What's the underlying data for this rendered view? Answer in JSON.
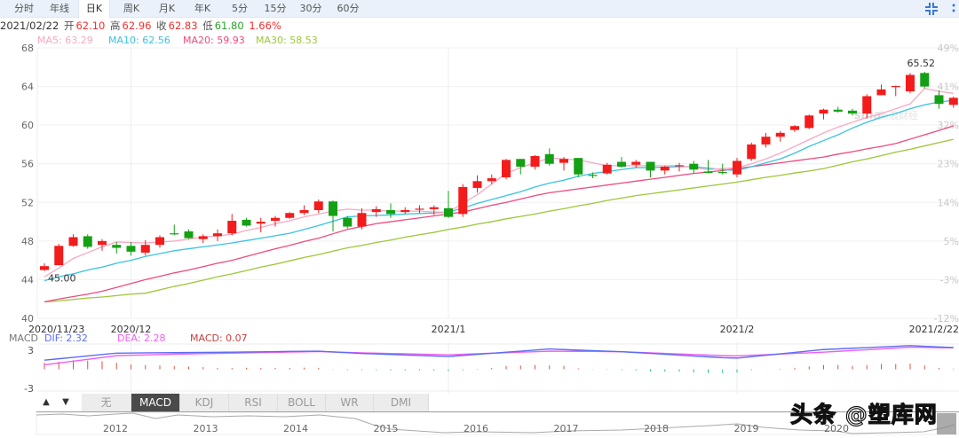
{
  "tabs": [
    {
      "label": "分时",
      "active": false
    },
    {
      "label": "年线",
      "active": false
    },
    {
      "label": "日K",
      "active": true
    },
    {
      "label": "周K",
      "active": false
    },
    {
      "label": "月K",
      "active": false
    },
    {
      "label": "年K",
      "active": false
    },
    {
      "label": "5分",
      "active": false
    },
    {
      "label": "15分",
      "active": false
    },
    {
      "label": "30分",
      "active": false
    },
    {
      "label": "60分",
      "active": false
    }
  ],
  "toolbar": {
    "fullscreen_icon": "collapse-fullscreen-icon",
    "more_icon": "vertical-dots-icon"
  },
  "quote": {
    "date": "2021/02/22",
    "open_label": "开",
    "open": "62.10",
    "high_label": "高",
    "high": "62.96",
    "close_label": "收",
    "close": "62.83",
    "low_label": "低",
    "low": "61.80",
    "change_pct": "1.66%"
  },
  "ma_legend": {
    "ma5": "MA5: 63.29",
    "ma10": "MA10: 62.56",
    "ma20": "MA20: 59.93",
    "ma30": "MA30: 58.53"
  },
  "colors": {
    "up": "#f21c1c",
    "down": "#14a014",
    "ma5": "#f7a8c4",
    "ma10": "#38c3e0",
    "ma20": "#ee4a7c",
    "ma30": "#9dc63a",
    "dif": "#5b6ef5",
    "dea": "#f05ef0",
    "tab_bg": "#eaf1fb",
    "indicator_active": "#4a4a4a"
  },
  "watermark_logo": "sina 新浪财经",
  "chart_data": {
    "type": "candlestick",
    "ylim": [
      40,
      68
    ],
    "y_ticks": [
      "68",
      "64",
      "60",
      "56",
      "52",
      "48",
      "44",
      "40"
    ],
    "y_ticks_right": [
      "49%",
      "41%",
      "32%",
      "23%",
      "14%",
      "5%",
      "-3%",
      "-12%"
    ],
    "x_labels": [
      {
        "label": "2020/11/23",
        "index": 0
      },
      {
        "label": "2020/12",
        "index": 6
      },
      {
        "label": "2021/1",
        "index": 28
      },
      {
        "label": "2021/2",
        "index": 48
      },
      {
        "label": "2021/2/22",
        "index": 63
      }
    ],
    "annotations": {
      "max": "65.52",
      "min": "45.00"
    },
    "ohlc": [
      [
        45.0,
        45.7,
        44.9,
        45.4
      ],
      [
        45.5,
        47.7,
        45.5,
        47.5
      ],
      [
        47.5,
        48.7,
        47.4,
        48.4
      ],
      [
        48.5,
        48.7,
        47.2,
        47.4
      ],
      [
        47.6,
        48.2,
        47.0,
        48.0
      ],
      [
        47.6,
        47.9,
        46.7,
        47.3
      ],
      [
        47.5,
        47.9,
        46.5,
        46.9
      ],
      [
        46.8,
        48.1,
        46.5,
        47.6
      ],
      [
        47.6,
        48.6,
        47.3,
        48.4
      ],
      [
        48.8,
        49.7,
        48.6,
        48.7
      ],
      [
        49.0,
        49.2,
        48.2,
        48.3
      ],
      [
        48.2,
        48.7,
        47.8,
        48.5
      ],
      [
        48.5,
        49.2,
        48.0,
        48.8
      ],
      [
        48.8,
        50.8,
        48.6,
        50.1
      ],
      [
        50.2,
        50.4,
        49.5,
        49.6
      ],
      [
        49.8,
        50.4,
        48.9,
        50.0
      ],
      [
        50.1,
        50.6,
        49.5,
        50.4
      ],
      [
        50.4,
        51.0,
        50.3,
        50.9
      ],
      [
        50.9,
        51.7,
        50.7,
        51.2
      ],
      [
        51.2,
        52.3,
        50.9,
        52.1
      ],
      [
        52.1,
        52.2,
        49.0,
        50.6
      ],
      [
        50.4,
        50.6,
        49.3,
        49.5
      ],
      [
        49.5,
        51.4,
        49.2,
        50.9
      ],
      [
        51.0,
        51.6,
        50.5,
        51.3
      ],
      [
        51.2,
        51.9,
        50.4,
        50.8
      ],
      [
        51.0,
        51.5,
        50.8,
        51.2
      ],
      [
        51.3,
        51.7,
        50.9,
        51.35
      ],
      [
        51.3,
        51.7,
        50.7,
        51.5
      ],
      [
        51.4,
        53.2,
        50.4,
        50.5
      ],
      [
        50.8,
        53.9,
        50.5,
        53.6
      ],
      [
        53.5,
        54.8,
        53.0,
        54.2
      ],
      [
        54.2,
        54.9,
        53.9,
        54.5
      ],
      [
        54.6,
        56.5,
        54.4,
        56.4
      ],
      [
        56.5,
        56.5,
        54.9,
        55.7
      ],
      [
        55.7,
        56.9,
        55.4,
        56.8
      ],
      [
        57.0,
        57.6,
        55.8,
        56.0
      ],
      [
        56.1,
        56.7,
        55.3,
        56.5
      ],
      [
        56.6,
        56.6,
        54.6,
        54.9
      ],
      [
        54.85,
        55.1,
        54.5,
        54.75
      ],
      [
        55.0,
        56.1,
        54.9,
        55.9
      ],
      [
        56.2,
        56.7,
        55.6,
        55.7
      ],
      [
        55.9,
        56.4,
        55.6,
        56.2
      ],
      [
        56.2,
        56.2,
        54.6,
        55.3
      ],
      [
        55.3,
        55.8,
        54.9,
        55.7
      ],
      [
        55.75,
        56.1,
        55.2,
        55.85
      ],
      [
        56.0,
        56.3,
        55.0,
        55.4
      ],
      [
        55.2,
        56.4,
        55.0,
        55.05
      ],
      [
        55.15,
        56.0,
        54.9,
        55.1
      ],
      [
        54.9,
        56.6,
        54.6,
        56.3
      ],
      [
        56.5,
        58.2,
        56.3,
        58.0
      ],
      [
        58.0,
        59.2,
        57.7,
        58.8
      ],
      [
        58.8,
        59.4,
        58.3,
        59.2
      ],
      [
        59.5,
        60.0,
        59.3,
        59.9
      ],
      [
        59.7,
        61.1,
        59.6,
        61.0
      ],
      [
        61.2,
        61.7,
        60.6,
        61.6
      ],
      [
        61.6,
        61.9,
        61.3,
        61.4
      ],
      [
        61.5,
        61.7,
        61.0,
        61.2
      ],
      [
        61.2,
        63.2,
        60.7,
        63.0
      ],
      [
        63.1,
        64.2,
        63.1,
        63.7
      ],
      [
        63.95,
        64.1,
        63.0,
        64.05
      ],
      [
        63.5,
        65.4,
        63.3,
        65.2
      ],
      [
        65.4,
        65.52,
        63.8,
        64.0
      ],
      [
        63.1,
        63.6,
        61.7,
        62.2
      ],
      [
        62.1,
        62.96,
        61.8,
        62.83
      ]
    ],
    "ma5": [
      44.3,
      45.2,
      46.2,
      46.8,
      47.4,
      47.9,
      47.85,
      47.8,
      47.9,
      48.0,
      48.2,
      48.4,
      48.55,
      48.7,
      49.1,
      49.4,
      49.8,
      50.1,
      50.5,
      50.8,
      51.1,
      51.3,
      51.2,
      51.2,
      51.1,
      51.1,
      51.1,
      51.0,
      51.0,
      51.9,
      52.8,
      53.9,
      55.0,
      55.6,
      56.1,
      56.6,
      56.5,
      56.4,
      56.1,
      55.8,
      55.8,
      55.8,
      55.8,
      55.8,
      55.8,
      55.6,
      55.4,
      55.5,
      55.6,
      56.0,
      56.5,
      57.1,
      57.8,
      58.5,
      59.2,
      59.8,
      60.3,
      60.8,
      61.2,
      61.7,
      62.2,
      63.8,
      63.5,
      63.29
    ],
    "ma10": [
      43.9,
      44.3,
      44.6,
      45.0,
      45.3,
      45.7,
      46.0,
      46.4,
      46.7,
      47.0,
      47.2,
      47.4,
      47.6,
      47.8,
      48.05,
      48.3,
      48.55,
      48.8,
      49.2,
      49.6,
      50.05,
      50.5,
      50.6,
      50.65,
      50.7,
      50.8,
      50.85,
      50.9,
      51.0,
      51.4,
      51.9,
      52.3,
      52.7,
      53.1,
      53.6,
      54.0,
      54.3,
      54.7,
      55.0,
      55.2,
      55.4,
      55.6,
      55.6,
      55.65,
      55.7,
      55.7,
      55.55,
      55.4,
      55.3,
      55.7,
      56.1,
      56.5,
      57.1,
      57.8,
      58.4,
      59.0,
      59.7,
      60.3,
      60.8,
      61.2,
      61.7,
      62.1,
      62.4,
      62.56
    ],
    "ma20": [
      41.7,
      42.0,
      42.25,
      42.5,
      42.8,
      43.2,
      43.6,
      44.0,
      44.35,
      44.7,
      45.0,
      45.35,
      45.7,
      46.0,
      46.4,
      46.8,
      47.2,
      47.55,
      47.95,
      48.3,
      48.75,
      49.2,
      49.5,
      49.8,
      50.0,
      50.2,
      50.4,
      50.6,
      50.8,
      51.0,
      51.35,
      51.7,
      52.0,
      52.35,
      52.7,
      53.0,
      53.2,
      53.4,
      53.6,
      53.8,
      54.0,
      54.2,
      54.4,
      54.6,
      54.8,
      55.0,
      55.15,
      55.3,
      55.5,
      55.7,
      55.9,
      56.1,
      56.3,
      56.5,
      56.7,
      57.0,
      57.25,
      57.55,
      57.8,
      58.1,
      58.55,
      59.0,
      59.45,
      59.93
    ],
    "ma30": [
      41.7,
      41.8,
      41.95,
      42.1,
      42.2,
      42.35,
      42.5,
      42.6,
      42.95,
      43.3,
      43.6,
      43.95,
      44.3,
      44.6,
      44.95,
      45.3,
      45.6,
      45.95,
      46.3,
      46.6,
      46.95,
      47.3,
      47.55,
      47.85,
      48.1,
      48.4,
      48.65,
      48.9,
      49.2,
      49.45,
      49.75,
      50.0,
      50.3,
      50.55,
      50.8,
      51.1,
      51.35,
      51.65,
      51.9,
      52.2,
      52.45,
      52.7,
      52.9,
      53.1,
      53.3,
      53.5,
      53.7,
      53.9,
      54.1,
      54.35,
      54.6,
      54.8,
      55.05,
      55.25,
      55.5,
      55.85,
      56.2,
      56.5,
      56.85,
      57.2,
      57.5,
      57.85,
      58.2,
      58.53
    ]
  },
  "macd": {
    "title": "MACD",
    "dif_label": "DIF: 2.32",
    "dea_label": "DEA: 2.28",
    "macd_label": "MACD: 0.07",
    "y_ticks": [
      "3",
      "-3"
    ],
    "dif": [
      0.97,
      1.12,
      1.27,
      1.42,
      1.57,
      1.72,
      1.73,
      1.75,
      1.76,
      1.77,
      1.78,
      1.8,
      1.81,
      1.82,
      1.84,
      1.86,
      1.88,
      1.9,
      1.92,
      1.93,
      1.85,
      1.76,
      1.68,
      1.63,
      1.58,
      1.52,
      1.47,
      1.41,
      1.36,
      1.47,
      1.59,
      1.7,
      1.82,
      1.93,
      2.05,
      2.16,
      2.1,
      2.04,
      1.99,
      1.93,
      1.87,
      1.78,
      1.69,
      1.6,
      1.5,
      1.41,
      1.32,
      1.23,
      1.19,
      1.34,
      1.49,
      1.64,
      1.8,
      1.95,
      2.1,
      2.17,
      2.24,
      2.31,
      2.38,
      2.45,
      2.52,
      2.45,
      2.38,
      2.32
    ],
    "dea": [
      0.48,
      0.67,
      0.87,
      1.06,
      1.26,
      1.45,
      1.49,
      1.53,
      1.57,
      1.61,
      1.64,
      1.67,
      1.69,
      1.72,
      1.75,
      1.78,
      1.8,
      1.83,
      1.86,
      1.89,
      1.84,
      1.8,
      1.75,
      1.72,
      1.68,
      1.65,
      1.61,
      1.58,
      1.54,
      1.6,
      1.65,
      1.71,
      1.76,
      1.82,
      1.87,
      1.93,
      1.92,
      1.91,
      1.9,
      1.88,
      1.87,
      1.81,
      1.75,
      1.69,
      1.63,
      1.57,
      1.51,
      1.45,
      1.42,
      1.49,
      1.55,
      1.62,
      1.69,
      1.75,
      1.82,
      1.91,
      2.0,
      2.08,
      2.17,
      2.26,
      2.35,
      2.33,
      2.3,
      2.28
    ],
    "hist": [
      0.69,
      0.8,
      0.95,
      0.93,
      0.85,
      0.7,
      0.5,
      0.45,
      0.4,
      0.35,
      0.28,
      0.23,
      0.15,
      0.15,
      0.15,
      0.15,
      0.15,
      0.15,
      0.18,
      0.15,
      0.02,
      -0.08,
      -0.1,
      -0.1,
      -0.12,
      -0.12,
      -0.12,
      -0.15,
      -0.2,
      -0.1,
      0.05,
      0.15,
      0.35,
      0.4,
      0.45,
      0.4,
      0.35,
      0.1,
      0.02,
      -0.05,
      -0.08,
      -0.12,
      -0.22,
      -0.25,
      -0.25,
      -0.35,
      -0.4,
      -0.42,
      -0.35,
      -0.1,
      0.01,
      0.05,
      0.15,
      0.3,
      0.45,
      0.45,
      0.35,
      0.45,
      0.55,
      0.55,
      0.6,
      0.4,
      0.15,
      0.07
    ]
  },
  "indicator_tabs": [
    {
      "label": "无",
      "active": false
    },
    {
      "label": "MACD",
      "active": true
    },
    {
      "label": "KDJ",
      "active": false
    },
    {
      "label": "RSI",
      "active": false
    },
    {
      "label": "BOLL",
      "active": false
    },
    {
      "label": "WR",
      "active": false
    },
    {
      "label": "DMI",
      "active": false
    }
  ],
  "scroll_buttons": {
    "up": "▲",
    "down": "▼"
  },
  "navigator": {
    "years": [
      "2012",
      "2013",
      "2014",
      "2015",
      "2016",
      "2017",
      "2018",
      "2019",
      "2020"
    ]
  },
  "overlay_watermark": "头条 @塑库网"
}
